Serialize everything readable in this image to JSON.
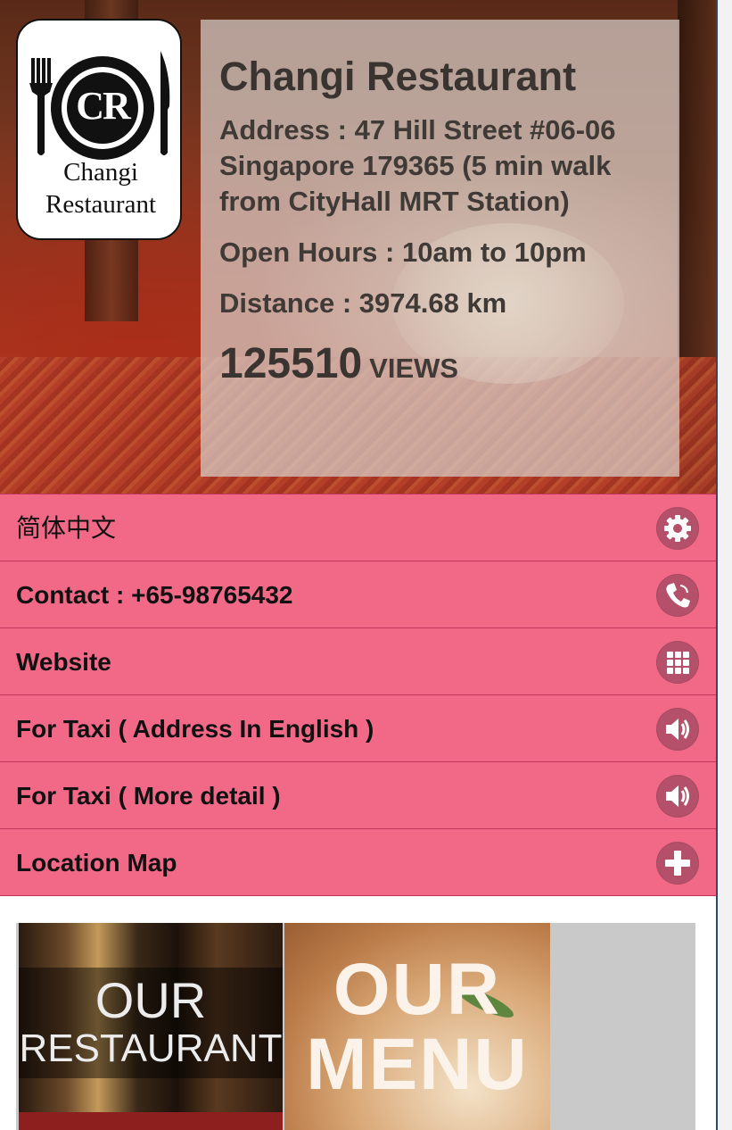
{
  "restaurant": {
    "logo": {
      "initials": "CR",
      "line1": "Changi",
      "line2": "Restaurant"
    },
    "name": "Changi Restaurant",
    "address": "Address : 47 Hill Street #06-06 Singapore 179365 (5 min walk from CityHall MRT Station)",
    "hours": "Open Hours : 10am to 10pm",
    "distance": "Distance : 3974.68 km",
    "views_count": "125510",
    "views_label": "VIEWS"
  },
  "menu": [
    {
      "label": "简体中文",
      "icon": "gear-icon"
    },
    {
      "label": "Contact : +65-98765432",
      "icon": "phone-icon"
    },
    {
      "label": "Website",
      "icon": "grid-icon"
    },
    {
      "label": "For Taxi ( Address In English )",
      "icon": "speaker-icon"
    },
    {
      "label": "For Taxi ( More detail )",
      "icon": "speaker-icon"
    },
    {
      "label": "Location Map",
      "icon": "plus-icon"
    }
  ],
  "tiles": [
    {
      "line1": "OUR",
      "line2": "RESTAURANT"
    },
    {
      "line1": "OUR",
      "line2": "MENU"
    }
  ],
  "colors": {
    "menu_bg": "#f26988",
    "menu_border": "#c2345a",
    "icon_bg": "#b5506a"
  }
}
